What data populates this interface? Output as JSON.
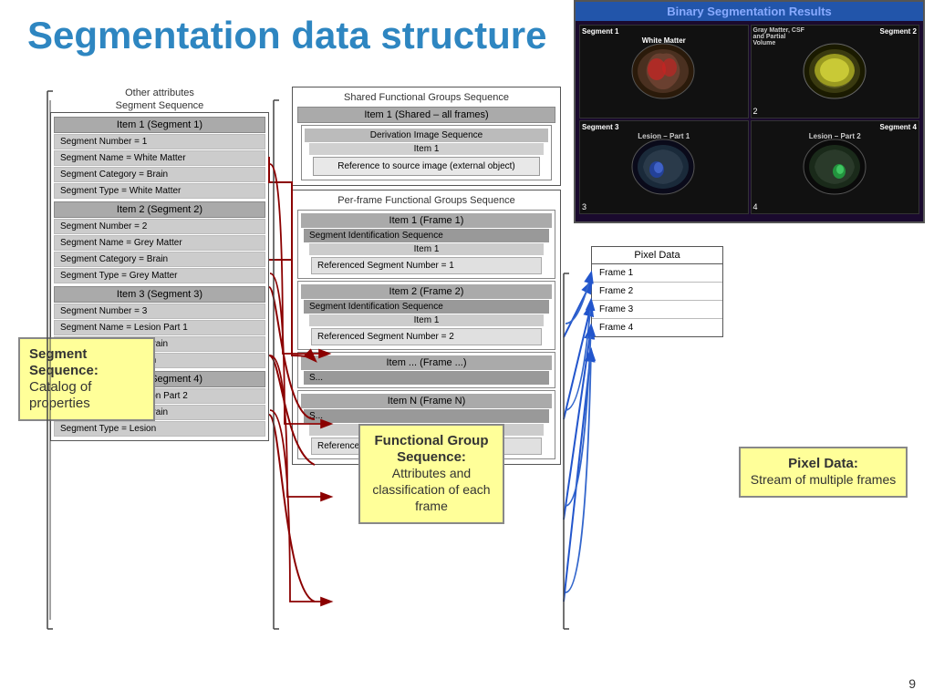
{
  "title": "Segmentation data structure",
  "page_number": "9",
  "segment_panel": {
    "other_attrs": "Other attributes",
    "segment_sequence": "Segment Sequence",
    "items": [
      {
        "header": "Item 1 (Segment 1)",
        "attrs": [
          "Segment Number = 1",
          "Segment Name = White Matter",
          "Segment Category = Brain",
          "Segment Type = White Matter"
        ]
      },
      {
        "header": "Item 2 (Segment 2)",
        "attrs": [
          "Segment Number = 2",
          "Segment Name = Grey Matter",
          "Segment Category = Brain",
          "Segment Type = Grey Matter"
        ]
      },
      {
        "header": "Item 3 (Segment 3)",
        "attrs": [
          "Segment Number = 3",
          "Segment Name = Lesion Part 1",
          "Segment Category = Brain",
          "Segment Type = Lesion"
        ]
      },
      {
        "header": "Item 4 (Segment 4)",
        "attrs": [
          "Segment Name = Lesion Part 2",
          "Segment Category = Brain",
          "Segment Type = Lesion"
        ]
      }
    ]
  },
  "functional_panel": {
    "shared_header": "Shared Functional Groups Sequence",
    "shared_item": "Item 1 (Shared – all frames)",
    "derivation_seq": "Derivation Image Sequence",
    "derivation_item": "Item 1",
    "reference_text": "Reference to source image (external object)",
    "per_frame_header": "Per-frame Functional Groups Sequence",
    "frames": [
      {
        "header": "Item 1 (Frame 1)",
        "seg_id_seq": "Segment Identification Sequence",
        "item": "Item 1",
        "ref_seg": "Referenced Segment Number = 1"
      },
      {
        "header": "Item 2 (Frame 2)",
        "seg_id_seq": "Segment Identification Sequence",
        "item": "Item 1",
        "ref_seg": "Referenced Segment Number = 2"
      },
      {
        "header": "Item ... (Frame ...)",
        "seg_id_seq": "S...",
        "item": "",
        "ref_seg": ""
      },
      {
        "header": "Item N (Frame N)",
        "seg_id_seq": "S...",
        "item": "",
        "ref_seg": "Referenced Segment Number = 4"
      }
    ]
  },
  "pixel_panel": {
    "header": "Pixel Data",
    "frames": [
      "Frame 1",
      "Frame 2",
      "Frame 3",
      "Frame 4"
    ]
  },
  "annotations": {
    "segment_sequence": {
      "title": "Segment Sequence:",
      "body": "Catalog of properties"
    },
    "functional_group": {
      "title": "Functional Group Sequence:",
      "body": "Attributes and classification of each frame"
    },
    "pixel_data": {
      "title": "Pixel Data:",
      "body": "Stream of multiple frames"
    }
  },
  "brain_panel": {
    "title": "Binary Segmentation Results",
    "segments": [
      {
        "label": "Segment 1",
        "sublabel": "White Matter",
        "number": ""
      },
      {
        "label": "Segment 2",
        "sublabel": "Gray Matter, CSF and Partial Volume",
        "number": "2"
      },
      {
        "label": "Segment 3",
        "sublabel": "Lesion – Part 1",
        "number": "3"
      },
      {
        "label": "Segment 4",
        "sublabel": "Lesion – Part 2",
        "number": "4"
      }
    ]
  }
}
